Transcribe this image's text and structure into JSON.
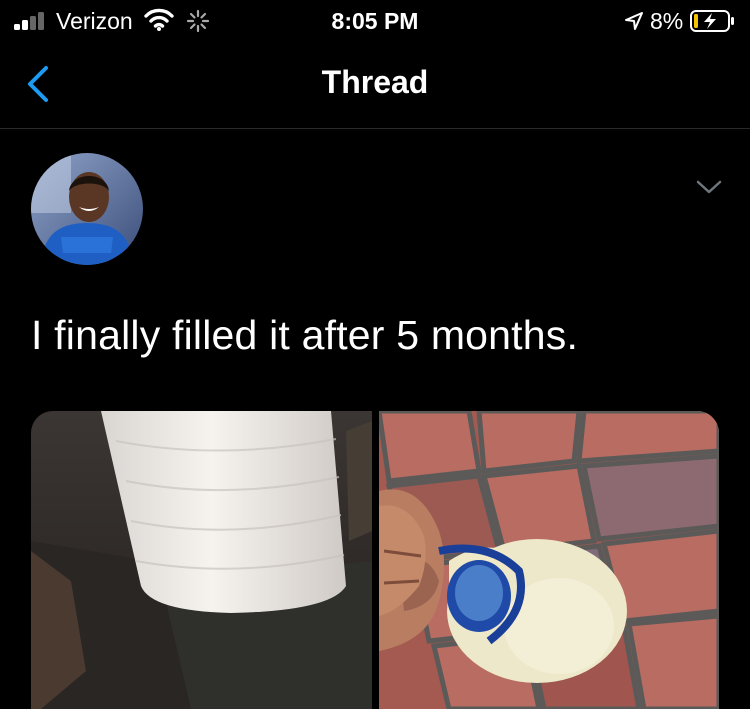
{
  "status_bar": {
    "carrier": "Verizon",
    "time": "8:05 PM",
    "battery_percent": "8%",
    "icons": [
      "signal-icon",
      "wifi-icon",
      "activity-spinner-icon",
      "location-arrow-icon",
      "battery-charging-icon"
    ]
  },
  "nav": {
    "title": "Thread",
    "back_icon": "back-chevron-icon"
  },
  "tweet": {
    "text": "I finally filled it after 5 months.",
    "menu_icon": "chevron-down-icon",
    "media": [
      {
        "name": "photo-bottle-on-table"
      },
      {
        "name": "photo-bottle-held-over-tiles"
      }
    ]
  },
  "colors": {
    "background": "#000000",
    "accent": "#1d9bf0",
    "divider": "#2a2a2a",
    "muted": "#6e767d"
  }
}
